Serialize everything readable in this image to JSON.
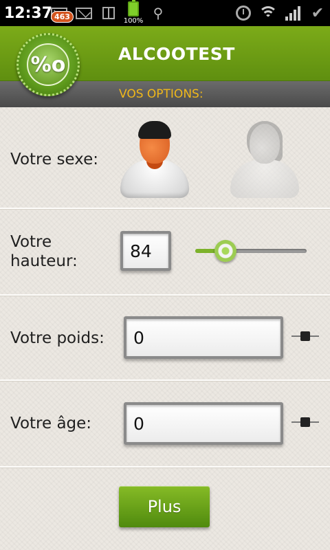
{
  "statusbar": {
    "time": "12:37",
    "notification_count": "463",
    "battery_level": "100%",
    "icons": [
      "mail-icon",
      "gift-icon",
      "battery-icon",
      "usb-icon",
      "alarm-icon",
      "wifi-icon",
      "signal-icon",
      "check-icon"
    ]
  },
  "header": {
    "title": "ALCOOTEST",
    "subtitle": "VOS OPTIONS:",
    "logo_symbol": "%o",
    "accent_color": "#6c9c14",
    "subtitle_color": "#f0b81a"
  },
  "form": {
    "sex_label": "Votre sexe:",
    "height_label_line1": "Votre",
    "height_label_line2": "hauteur:",
    "height_value": "84",
    "height_slider_fraction": 0.27,
    "weight_label": "Votre poids:",
    "weight_value": "0",
    "age_label": "Votre âge:",
    "age_value": "0"
  },
  "actions": {
    "plus_label": "Plus"
  }
}
